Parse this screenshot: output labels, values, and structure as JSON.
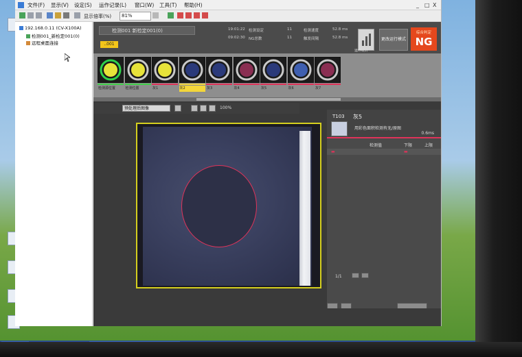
{
  "window": {
    "menus": [
      "文件(F)",
      "显示(V)",
      "设定(S)",
      "运作记录(L)",
      "窗口(W)",
      "工具(T)",
      "帮助(H)"
    ],
    "window_buttons": [
      "_",
      "□",
      "X"
    ]
  },
  "toolbar": {
    "display_ratio_label": "显示倍率(%)",
    "display_ratio_value": "81%"
  },
  "tree": {
    "root": "192.168.0.11 (CV-X100A)",
    "child": "检测001_新检定001(0)",
    "remote": "远程桌面连接"
  },
  "app": {
    "program_name": "检测001 新检定001(0)",
    "program_tag": "..001",
    "stats": [
      {
        "a": "19:01:22",
        "b": "检测设定",
        "c": "11",
        "d": "检测速度",
        "e": "52.8 ms"
      },
      {
        "a": "09:02:30",
        "b": "NG总数",
        "c": "11",
        "d": "触发间隔",
        "e": "52.8 ms"
      }
    ],
    "stats_button_label": "运作统计",
    "run_mode_button": "更改运行模式",
    "judgement_sub": "综合判定",
    "judgement": "NG"
  },
  "thumbnails": [
    {
      "label": "检测源位置",
      "ring": "#2fd14a",
      "center": "#e7e33a",
      "bar": "#41d04a",
      "selected": false
    },
    {
      "label": "检测位置",
      "ring": "#c9c9c9",
      "center": "#e7e33a",
      "bar": "#41d04a",
      "selected": false
    },
    {
      "label": "灰1",
      "ring": "#c9c9c9",
      "center": "#e7e33a",
      "bar": "#e0335a",
      "selected": false
    },
    {
      "label": "灰2",
      "ring": "#c9c9c9",
      "center": "#2b3a7a",
      "bar": "#f3d63a",
      "selected": true
    },
    {
      "label": "灰3",
      "ring": "#c9c9c9",
      "center": "#2b3a7a",
      "bar": "#e0335a",
      "selected": false
    },
    {
      "label": "灰4",
      "ring": "#c9c9c9",
      "center": "#8a2e52",
      "bar": "#e0335a",
      "selected": false
    },
    {
      "label": "灰5",
      "ring": "#c9c9c9",
      "center": "#2b3a7a",
      "bar": "#e0335a",
      "selected": false
    },
    {
      "label": "灰6",
      "ring": "#c9c9c9",
      "center": "#3f5fb0",
      "bar": "#e0335a",
      "selected": false
    },
    {
      "label": "灰7",
      "ring": "#c9c9c9",
      "center": "#8a2e52",
      "bar": "#e0335a",
      "selected": false
    }
  ],
  "image_tools": {
    "view_select": "预处理后图像",
    "zoom": "100%"
  },
  "tool_panel": {
    "id": "T103",
    "name": "灰5",
    "description": "用彩色面积检测有无/原图",
    "time": "0.6ms",
    "columns": [
      "检测值",
      "下限",
      "上限"
    ],
    "pager": "1/1"
  },
  "colors": {
    "accent_ng": "#e5481d",
    "selection": "#f3d63a",
    "measure_red": "#e0335a"
  }
}
